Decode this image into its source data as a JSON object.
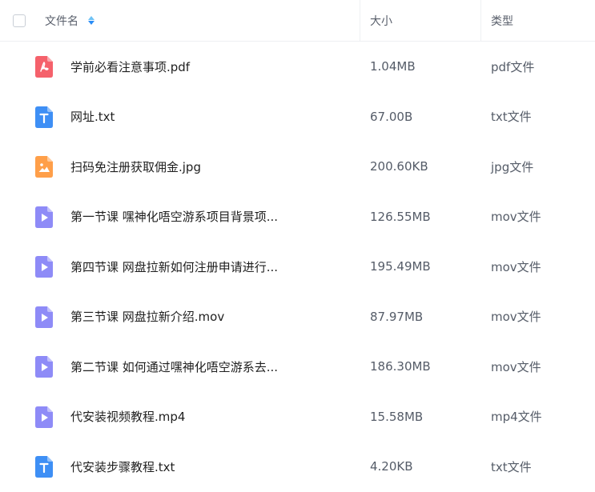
{
  "header": {
    "name": "文件名",
    "size": "大小",
    "type": "类型"
  },
  "colors": {
    "pdf": "#f5616b",
    "txt": "#3e8ff5",
    "jpg": "#ff9f49",
    "video": "#8e8bf7"
  },
  "files": [
    {
      "name": "学前必看注意事项.pdf",
      "size": "1.04MB",
      "type": "pdf文件",
      "icon": "pdf-icon"
    },
    {
      "name": "网址.txt",
      "size": "67.00B",
      "type": "txt文件",
      "icon": "txt-icon"
    },
    {
      "name": "扫码免注册获取佣金.jpg",
      "size": "200.60KB",
      "type": "jpg文件",
      "icon": "image-icon"
    },
    {
      "name": "第一节课 嘿神化唔空游系项目背景项...",
      "size": "126.55MB",
      "type": "mov文件",
      "icon": "video-icon"
    },
    {
      "name": "第四节课 网盘拉新如何注册申请进行...",
      "size": "195.49MB",
      "type": "mov文件",
      "icon": "video-icon"
    },
    {
      "name": "第三节课 网盘拉新介绍.mov",
      "size": "87.97MB",
      "type": "mov文件",
      "icon": "video-icon"
    },
    {
      "name": "第二节课 如何通过嘿神化唔空游系去...",
      "size": "186.30MB",
      "type": "mov文件",
      "icon": "video-icon"
    },
    {
      "name": "代安装视频教程.mp4",
      "size": "15.58MB",
      "type": "mp4文件",
      "icon": "video-icon"
    },
    {
      "name": "代安装步骤教程.txt",
      "size": "4.20KB",
      "type": "txt文件",
      "icon": "txt-icon"
    }
  ]
}
